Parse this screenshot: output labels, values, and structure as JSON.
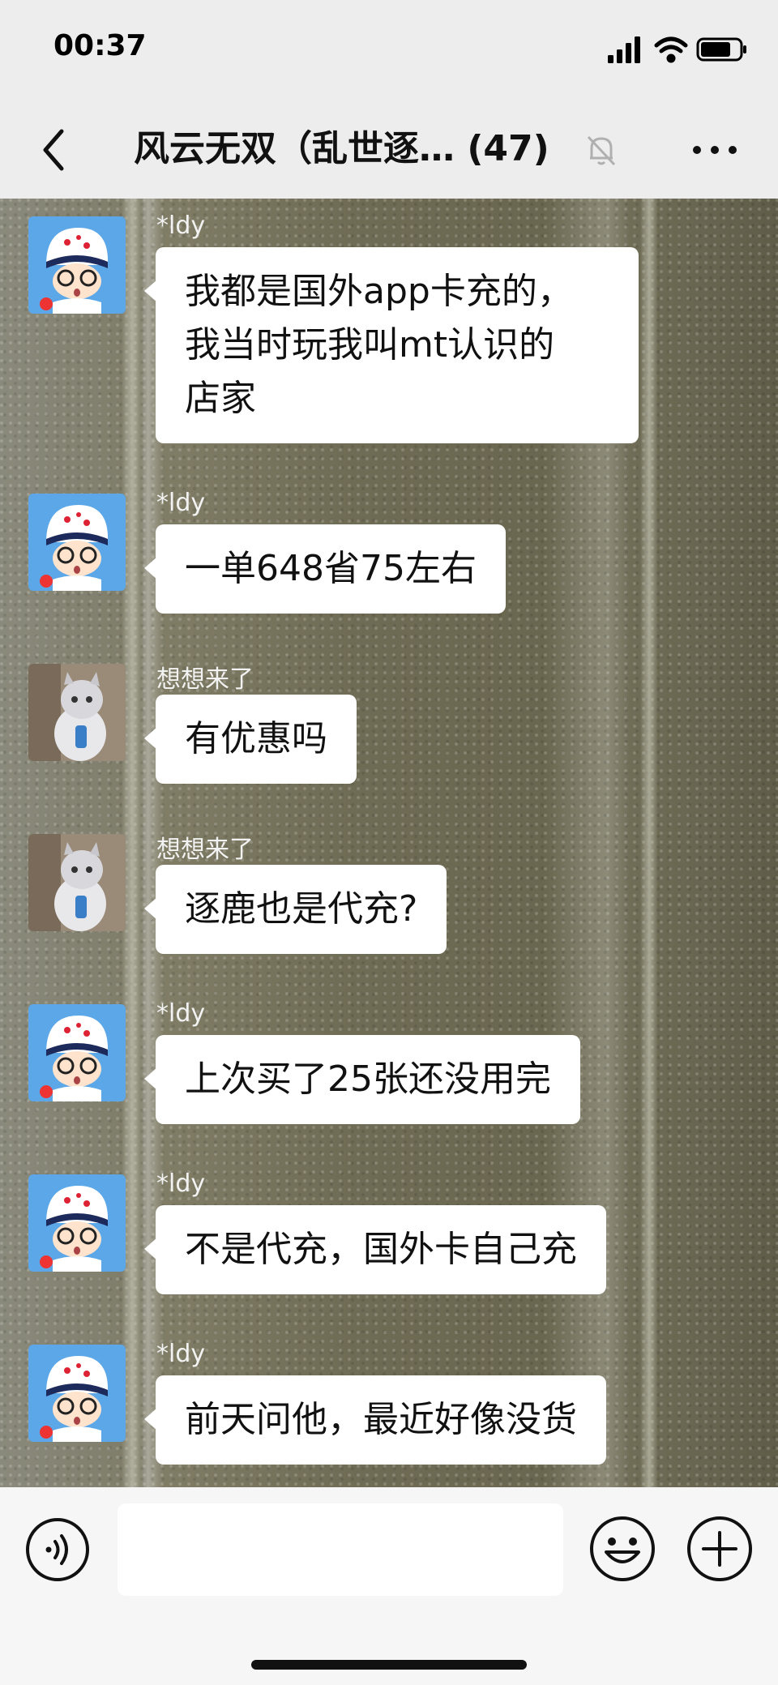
{
  "status_bar": {
    "time": "00:37",
    "icons": [
      "signal-icon",
      "wifi-icon",
      "battery-icon"
    ]
  },
  "header": {
    "title": "风云无双（乱世逐… (47)",
    "back_icon": "chevron-left-icon",
    "mute_icon": "bell-muted-icon",
    "more_icon": "more-dots-icon"
  },
  "messages": [
    {
      "sender": "*ldy",
      "text": "我都是国外app卡充的，\n我当时玩我叫mt认识的\n店家"
    },
    {
      "sender": "*ldy",
      "text": "一单648省75左右"
    },
    {
      "sender": "想想来了",
      "text": "有优惠吗"
    },
    {
      "sender": "想想来了",
      "text": "逐鹿也是代充?"
    },
    {
      "sender": "*ldy",
      "text": "上次买了25张还没用完"
    },
    {
      "sender": "*ldy",
      "text": "不是代充，国外卡自己充"
    },
    {
      "sender": "*ldy",
      "text": "前天问他，最近好像没货"
    }
  ],
  "input_bar": {
    "input_value": "",
    "voice_icon": "voice-icon",
    "emoji_icon": "emoji-icon",
    "plus_icon": "plus-icon"
  },
  "colors": {
    "bubble": "#ffffff",
    "header_bg": "#ededed",
    "input_bg": "#f6f6f6"
  }
}
